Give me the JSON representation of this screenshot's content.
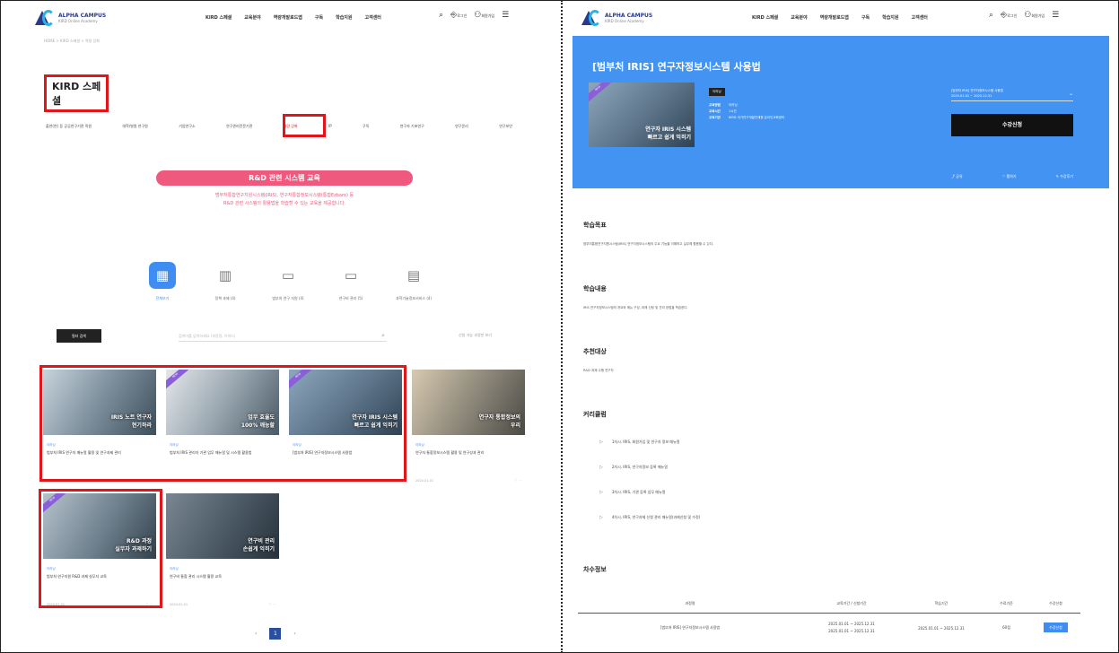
{
  "brand": {
    "name": "ALPHA CAMPUS",
    "sub": "KIRD Online Academy"
  },
  "nav": {
    "items": [
      "KIRD 스페셜",
      "교육분야",
      "역량개발로드맵",
      "구독",
      "학습지원",
      "고객센터"
    ]
  },
  "header_icons": {
    "login": "로그인",
    "join": "회원가입"
  },
  "left": {
    "breadcrumb": "HOME > KIRD 스페셜 > 역량 강화",
    "page_title": "KIRD 스페셜",
    "tabs": [
      "출연(연) 등 공공연구기관 직원",
      "대학/병원 연구원",
      "기업연구소",
      "연구관리전문기관",
      "역량 강화",
      "IP",
      "구독",
      "연구자 기초연구",
      "연구윤리",
      "연구보안"
    ],
    "active_tab_index": 4,
    "banner_title": "R&D 관련 시스템 교육",
    "banner_sub_1": "범부처통합연구지원시스템(IRIS), 연구자통합정보시스템(통합Ezbaro) 등",
    "banner_sub_2": "R&D 관련 시스템의 활용법을 학습할 수 있는 교육을 제공합니다.",
    "categories": [
      {
        "label": "전체보기",
        "icon": "grid-icon"
      },
      {
        "label": "정책 과제 (4)",
        "icon": "building-icon"
      },
      {
        "label": "범부처 연구 지원 (4)",
        "icon": "monitor-icon"
      },
      {
        "label": "연구비 관리 (5)",
        "icon": "monitor-icon"
      },
      {
        "label": "과학기술정보서비스 (4)",
        "icon": "laptop-icon"
      }
    ],
    "filter_label": "필터 검색",
    "search_placeholder": "검색어를 입력하세요 (과정명, 키워드)",
    "toggle_label": "신청 가능 과정만 보기",
    "cards": [
      {
        "thumb_text_1": "IRIS 노트 연구자",
        "thumb_text_2": "현기하라",
        "meta": "이러닝",
        "title": "범부처 IRIS 연구자 매뉴얼 활용 및 연구과제 관리",
        "foot": "2024.01.01"
      },
      {
        "thumb_text_1": "업무 효율도",
        "thumb_text_2": "100% 깨능할",
        "meta": "이러닝",
        "title": "범부처 IRIS 관리자 기관 업무 매뉴얼 및 시스템 활용법",
        "foot": "2024.01.01"
      },
      {
        "thumb_text_1": "연구자 IRIS 시스템",
        "thumb_text_2": "빠르고 쉽게 익히기",
        "meta": "이러닝",
        "title": "[범부처 IRIS] 연구자정보시스템 사용법",
        "foot": "2024.01.01"
      },
      {
        "thumb_text_1": "연구자 통합정보의",
        "thumb_text_2": "우리",
        "meta": "이러닝",
        "title": "연구자 통합정보시스템 활용 및 연구성과 관리",
        "foot": "2024.01.01"
      },
      {
        "thumb_text_1": "R&D 과정",
        "thumb_text_2": "실무자 과제하기",
        "meta": "이러닝",
        "title": "범부처 연구지원 R&D 과제 실무자 교육",
        "foot": "2024.01.01"
      },
      {
        "thumb_text_1": "연구비 관리",
        "thumb_text_2": "손쉽게 익히기",
        "meta": "이러닝",
        "title": "연구비 통합 관리 시스템 활용 교육",
        "foot": "2024.01.01"
      }
    ],
    "pager": {
      "prev": "‹",
      "current": "1",
      "next": "›"
    }
  },
  "right": {
    "hero_title": "[범부처 IRIS] 연구자정보시스템 사용법",
    "hero_thumb_text_1": "연구자 IRIS 시스템",
    "hero_thumb_text_2": "빠르고 쉽게 익히기",
    "chip": "이러닝",
    "info": [
      {
        "k": "교육방법",
        "v": "이러닝"
      },
      {
        "k": "교육시간",
        "v": "1시간"
      },
      {
        "k": "교육기관",
        "v": "KIRD 국가연구개발인재원 온라인교육센터"
      }
    ],
    "select_line_1": "[범부처 IRIS] 연구자정보시스템 사용법",
    "select_line_2": "2025.01.01 ~ 2025.12.31",
    "apply_label": "수강신청",
    "actions": [
      "공유",
      "찜하기",
      "수강후기"
    ],
    "sections": [
      {
        "h": "학습목표",
        "t": "범부처통합연구지원시스템(IRIS) 연구자정보시스템의 주요 기능을 이해하고 실무에 활용할 수 있다."
      },
      {
        "h": "학습내용",
        "t": "IRIS 연구자정보시스템의 개요와 메뉴 구성, 과제 신청 및 관리 방법을 학습한다."
      },
      {
        "h": "추천대상",
        "t": "R&D 과제 수행 연구자"
      }
    ],
    "curriculum_title": "커리큘럼",
    "curriculum": [
      "1차시. IRIS, 회원가입 및 연구자 정보 매뉴얼",
      "2차시. IRIS, 연구자정보 등록 매뉴얼",
      "3차시. IRIS, 기관 등록 업무 매뉴얼",
      "4차시. IRIS, 연구과제 신청 관리 매뉴얼(과제신청 및 수정)"
    ],
    "table_title": "차수정보",
    "table_headers": [
      "과정명",
      "교육기간 / 신청기간",
      "학습기간",
      "수료기준",
      "수강신청"
    ],
    "table_row": {
      "name": "[범부처 IRIS] 연구자정보시스템 사용법",
      "period_1": "2025.01.01 ~ 2025.12.31",
      "period_2": "2025.01.01 ~ 2025.12.31",
      "study": "2025.01.01 ~ 2025.12.31",
      "criteria": "60점",
      "btn": "수강신청"
    }
  }
}
